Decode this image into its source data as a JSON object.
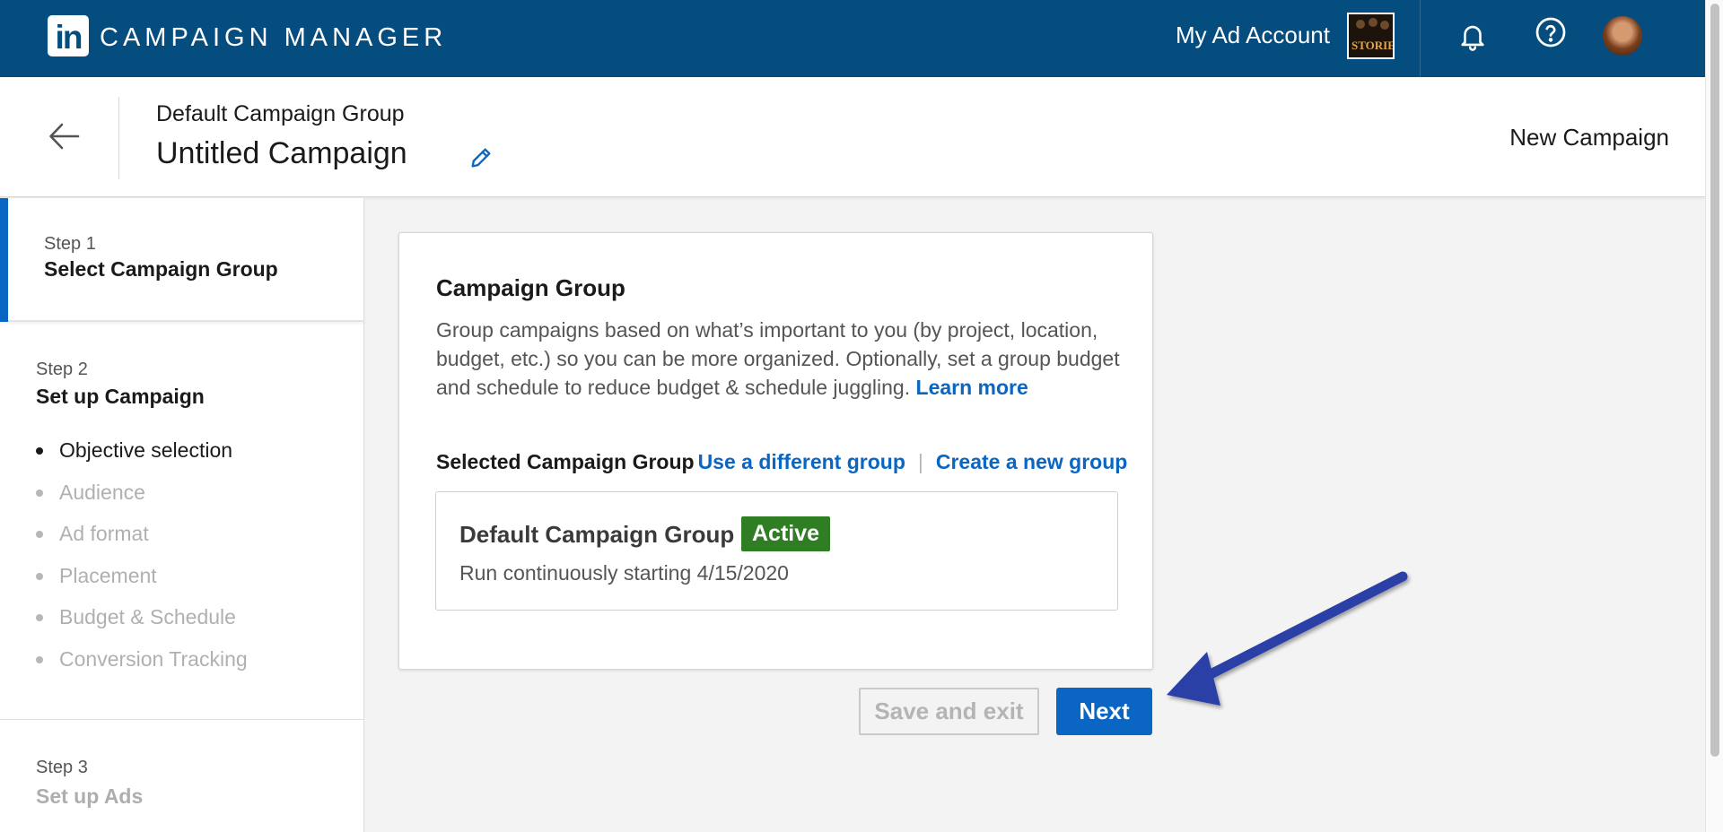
{
  "topbar": {
    "logo_text": "in",
    "app_title": "CAMPAIGN MANAGER",
    "account_name": "My Ad Account",
    "account_thumb_text": "STORIES"
  },
  "header": {
    "group_name": "Default Campaign Group",
    "campaign_name": "Untitled Campaign",
    "new_campaign": "New Campaign"
  },
  "sidebar": {
    "step1": {
      "label": "Step 1",
      "title": "Select Campaign Group"
    },
    "step2": {
      "label": "Step 2",
      "title": "Set up Campaign"
    },
    "substeps": [
      "Objective selection",
      "Audience",
      "Ad format",
      "Placement",
      "Budget & Schedule",
      "Conversion Tracking"
    ],
    "step3": {
      "label": "Step 3",
      "title": "Set up Ads"
    }
  },
  "card": {
    "title": "Campaign Group",
    "description": "Group campaigns based on what’s important to you (by project, location, budget, etc.) so you can be more organized. Optionally, set a group budget and schedule to reduce budget & schedule juggling.",
    "learn_more": "Learn more",
    "selected_label": "Selected Campaign Group",
    "use_different": "Use a different group",
    "pipe": "|",
    "create_new": "Create a new group",
    "group": {
      "name": "Default Campaign Group",
      "status": "Active",
      "schedule": "Run continuously starting 4/15/2020"
    }
  },
  "actions": {
    "save_exit": "Save and exit",
    "next": "Next"
  },
  "colors": {
    "topbar": "#054d7f",
    "primary": "#0a66c2",
    "active_badge": "#2f7e23",
    "annotation_arrow": "#2a3fa6"
  }
}
